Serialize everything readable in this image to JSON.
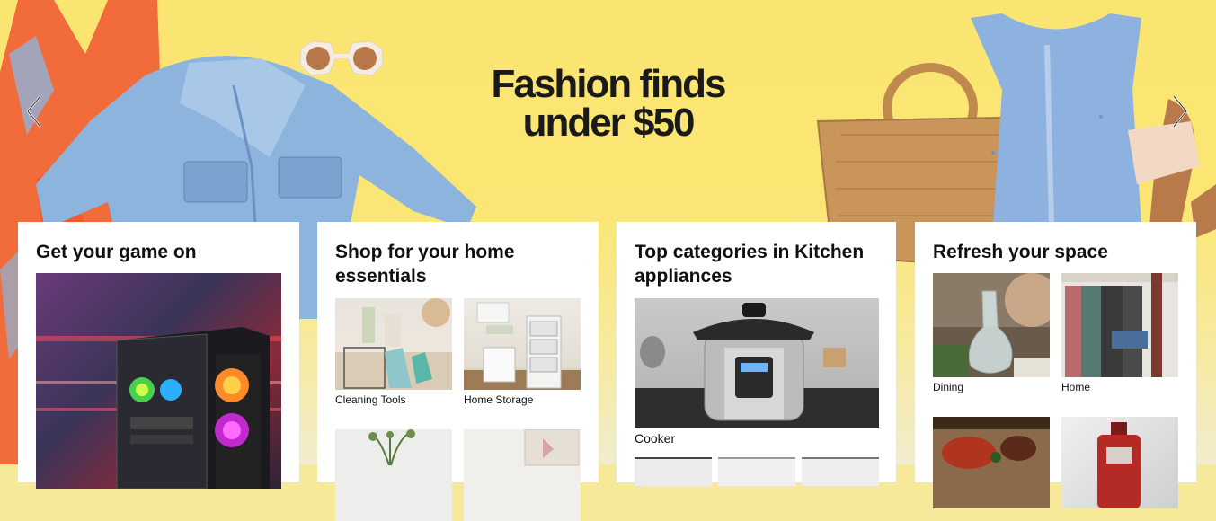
{
  "hero": {
    "headline_line1": "Fashion finds",
    "headline_line2": "under $50",
    "prev_icon": "chevron-left-icon",
    "next_icon": "chevron-right-icon",
    "background": "#fbe571"
  },
  "cards": [
    {
      "title": "Get your game on"
    },
    {
      "title": "Shop for your home essentials",
      "items": [
        {
          "label": "Cleaning Tools"
        },
        {
          "label": "Home Storage"
        }
      ]
    },
    {
      "title": "Top categories in Kitchen appliances",
      "featured_label": "Cooker"
    },
    {
      "title": "Refresh your space",
      "items": [
        {
          "label": "Dining"
        },
        {
          "label": "Home"
        }
      ]
    }
  ]
}
